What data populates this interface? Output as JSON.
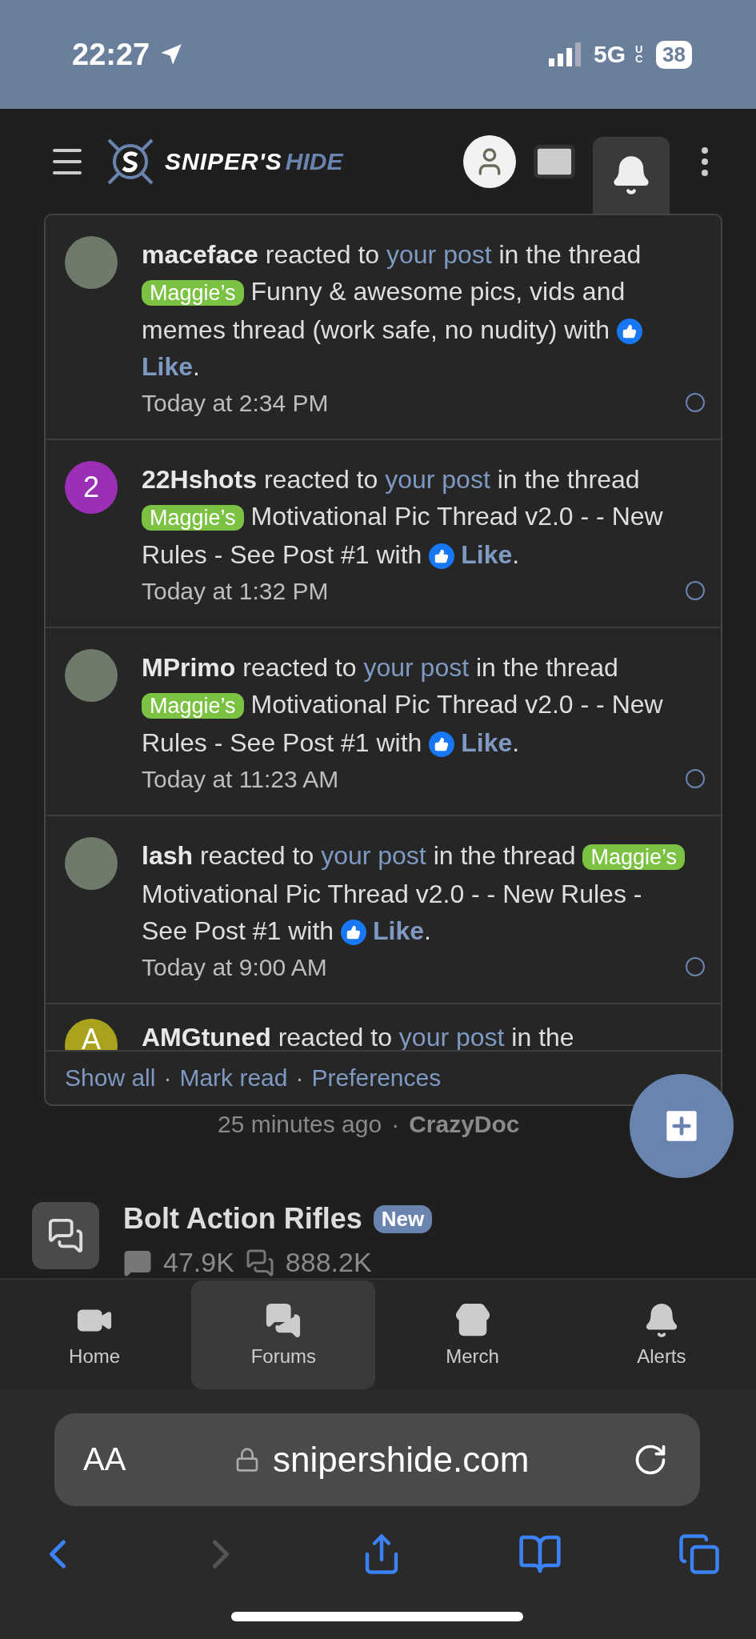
{
  "status_bar": {
    "time": "22:27",
    "network": "5G",
    "network_sub": "UC",
    "battery": "38"
  },
  "header": {
    "logo_main": "SNIPER'S",
    "logo_accent": "HIDE",
    "alerts_open": true
  },
  "notifications": {
    "items": [
      {
        "user": "maceface",
        "action": "reacted to",
        "link": "your post",
        "context": "in the thread",
        "tag": "Maggie’s",
        "thread": "Funny & awesome pics, vids and memes thread (work safe, no nudity) with",
        "reaction": "Like",
        "end": ".",
        "time": "Today at 2:34 PM",
        "avatar": {
          "kind": "photo"
        },
        "read": false
      },
      {
        "user": "22Hshots",
        "action": "reacted to",
        "link": "your post",
        "context": "in the thread",
        "tag": "Maggie’s",
        "thread": "Motivational Pic Thread v2.0 - - New Rules - See Post #1 with",
        "reaction": "Like",
        "end": ".",
        "time": "Today at 1:32 PM",
        "avatar": {
          "kind": "letter",
          "letter": "2",
          "color": "#9b2fb5"
        },
        "read": false
      },
      {
        "user": "MPrimo",
        "action": "reacted to",
        "link": "your post",
        "context": "in the thread",
        "tag": "Maggie’s",
        "thread": "Motivational Pic Thread v2.0 - - New Rules - See Post #1 with",
        "reaction": "Like",
        "end": ".",
        "time": "Today at 11:23 AM",
        "avatar": {
          "kind": "photo"
        },
        "read": false
      },
      {
        "user": "lash",
        "action": "reacted to",
        "link": "your post",
        "context": "in the thread",
        "tag": "Maggie’s",
        "thread": "Motivational Pic Thread v2.0 - - New Rules - See Post #1 with",
        "reaction": "Like",
        "end": ".",
        "time": "Today at 9:00 AM",
        "avatar": {
          "kind": "photo"
        },
        "read": false
      },
      {
        "user": "AMGtuned",
        "action": "reacted to",
        "link": "your post",
        "context": "in the",
        "avatar": {
          "kind": "letter",
          "letter": "A",
          "color": "#a8a21c"
        }
      }
    ],
    "footer": {
      "separator": "·",
      "links": [
        "Show all",
        "Mark read",
        "Preferences"
      ]
    }
  },
  "latest_post": {
    "time": "25 minutes ago",
    "separator": "·",
    "author": "CrazyDoc"
  },
  "forum": {
    "title": "Bolt Action Rifles",
    "badge": "New",
    "threads": "47.9K",
    "messages": "888.2K"
  },
  "bottom_nav": [
    {
      "label": "Home",
      "selected": false
    },
    {
      "label": "Forums",
      "selected": true
    },
    {
      "label": "Merch",
      "selected": false
    },
    {
      "label": "Alerts",
      "selected": false
    }
  ],
  "browser": {
    "text_size": "AA",
    "url": "snipershide.com",
    "back_enabled": true,
    "forward_enabled": false
  }
}
